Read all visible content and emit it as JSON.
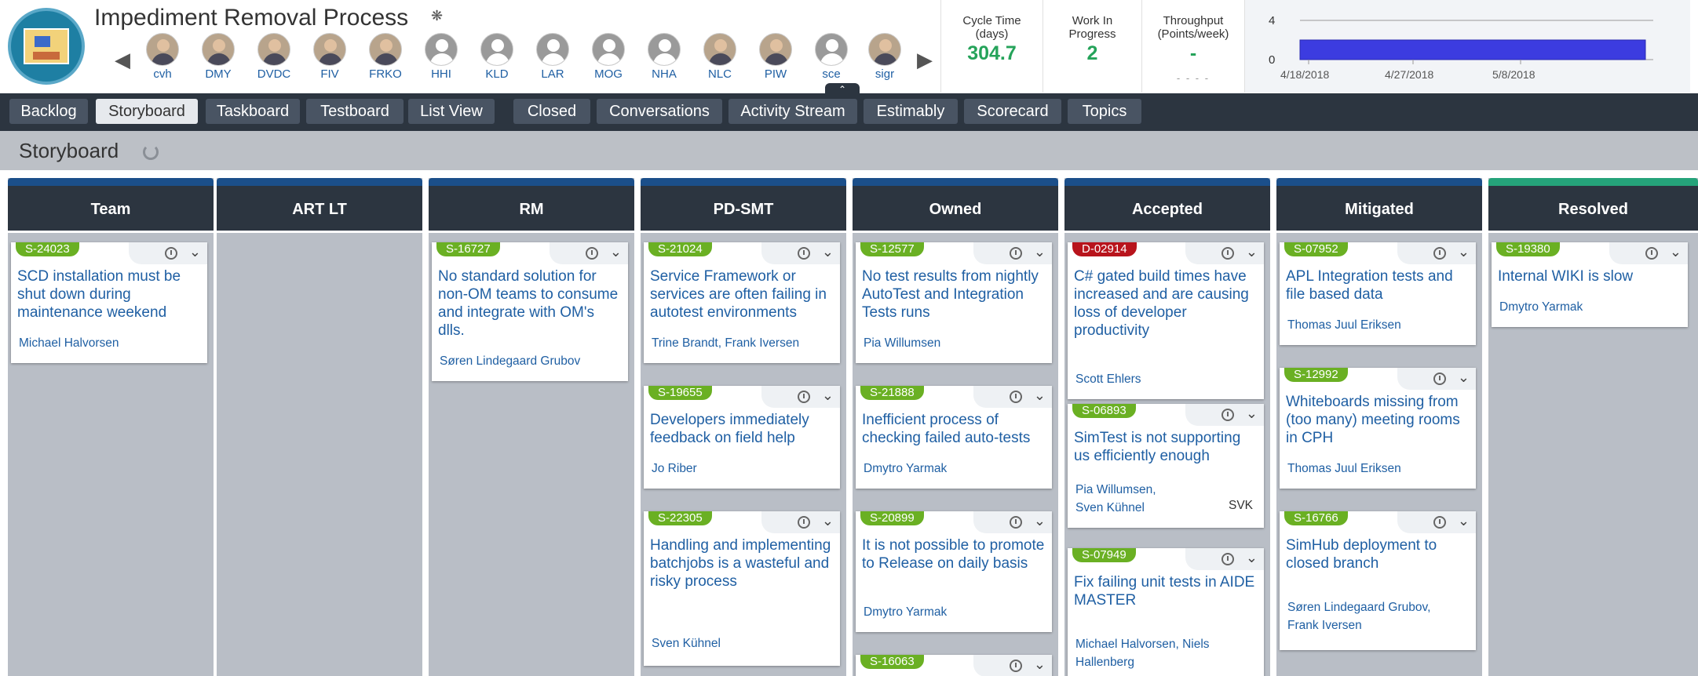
{
  "app": {
    "title": "Impediment Removal Process"
  },
  "team_members": [
    "cvh",
    "DMY",
    "DVDC",
    "FIV",
    "FRKO",
    "HHI",
    "KLD",
    "LAR",
    "MOG",
    "NHA",
    "NLC",
    "PIW",
    "sce",
    "sigr"
  ],
  "metrics": {
    "cycle_time": {
      "label_line1": "Cycle Time",
      "label_line2": "(days)",
      "value": "304.7"
    },
    "wip": {
      "label_line1": "Work In",
      "label_line2": "Progress",
      "value": "2"
    },
    "throughput": {
      "label_line1": "Throughput",
      "label_line2": "(Points/week)",
      "value": "-",
      "dash": "- - - -"
    }
  },
  "chart_data": {
    "type": "area",
    "x": [
      "4/18/2018",
      "4/27/2018",
      "5/8/2018"
    ],
    "y_ticks": [
      "4",
      "0"
    ],
    "ylim": [
      0,
      4
    ],
    "series": [
      {
        "values": [
          2,
          2,
          2
        ]
      }
    ],
    "color": "#3c3ce0"
  },
  "tabs": [
    "Backlog",
    "Storyboard",
    "Taskboard",
    "Testboard",
    "List View",
    "Closed",
    "Conversations",
    "Activity Stream",
    "Estimably",
    "Scorecard",
    "Topics"
  ],
  "active_tab": "Storyboard",
  "page": {
    "title": "Storyboard"
  },
  "columns": [
    {
      "name": "Team",
      "cards": [
        {
          "id": "S-24023",
          "title": "SCD installation must be shut down during maintenance weekend",
          "owners": "Michael Halvorsen",
          "type": "story"
        }
      ]
    },
    {
      "name": "ART LT",
      "cards": []
    },
    {
      "name": "RM",
      "cards": [
        {
          "id": "S-16727",
          "title": "No standard solution for non-OM teams to consume and integrate with OM's dlls.",
          "owners": "Søren Lindegaard Grubov",
          "type": "story"
        }
      ]
    },
    {
      "name": "PD-SMT",
      "cards": [
        {
          "id": "S-21024",
          "title": "Service Framework or services are often failing in autotest environments",
          "owners": "Trine Brandt, Frank Iversen",
          "type": "story"
        },
        {
          "id": "S-19655",
          "title": "Developers immediately feedback on field help",
          "owners": "Jo Riber",
          "type": "story"
        },
        {
          "id": "S-22305",
          "title": "Handling and implementing batchjobs is a wasteful and risky process",
          "owners": "Sven Kühnel",
          "type": "story"
        }
      ]
    },
    {
      "name": "Owned",
      "cards": [
        {
          "id": "S-12577",
          "title": "No test results from nightly AutoTest and Integration Tests runs",
          "owners": "Pia Willumsen",
          "type": "story"
        },
        {
          "id": "S-21888",
          "title": "Inefficient process of checking failed auto-tests",
          "owners": "Dmytro Yarmak",
          "type": "story"
        },
        {
          "id": "S-20899",
          "title": "It is not possible to promote to Release on daily basis",
          "owners": "Dmytro Yarmak",
          "type": "story"
        },
        {
          "id": "S-16063",
          "title": "",
          "owners": "",
          "type": "story"
        }
      ]
    },
    {
      "name": "Accepted",
      "cards": [
        {
          "id": "D-02914",
          "title": "C# gated build times have increased and are causing loss of developer productivity",
          "owners": "Scott Ehlers",
          "type": "defect"
        },
        {
          "id": "S-06893",
          "title": "SimTest is not supporting us efficiently enough",
          "owners_line1": "Pia Willumsen,",
          "owners_line2": "Sven Kühnel",
          "tag": "SVK",
          "type": "story"
        },
        {
          "id": "S-07949",
          "title": "Fix failing unit tests in AIDE MASTER",
          "owners_line1": "Michael Halvorsen, Niels",
          "owners_line2": "Hallenberg",
          "type": "story"
        }
      ]
    },
    {
      "name": "Mitigated",
      "cards": [
        {
          "id": "S-07952",
          "title": "APL Integration tests and file based data",
          "owners": "Thomas Juul Eriksen",
          "type": "story"
        },
        {
          "id": "S-12992",
          "title": "Whiteboards missing from (too many) meeting rooms in CPH",
          "owners": "Thomas Juul Eriksen",
          "type": "story"
        },
        {
          "id": "S-16766",
          "title": "SimHub deployment to closed branch",
          "owners_line1": "Søren Lindegaard Grubov,",
          "owners_line2": "Frank Iversen",
          "type": "story"
        }
      ]
    },
    {
      "name": "Resolved",
      "cards": [
        {
          "id": "S-19380",
          "title": "Internal WIKI is slow",
          "owners": "Dmytro Yarmak",
          "type": "story"
        }
      ]
    }
  ]
}
